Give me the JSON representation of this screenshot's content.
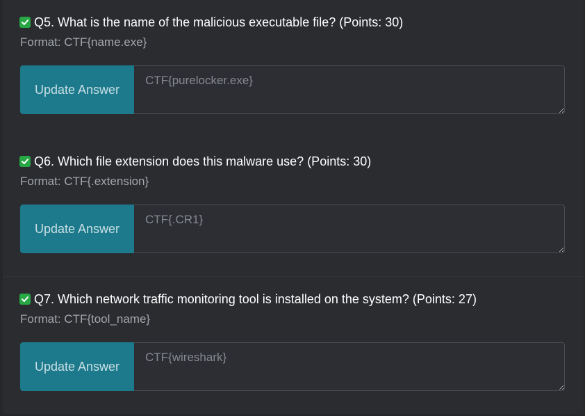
{
  "colors": {
    "background": "#25272b",
    "card": "#2a2c30",
    "accent_button": "#1d7a8c",
    "check": "#28a745",
    "title_text": "#ffffff",
    "muted_text": "#a3a6ab"
  },
  "questions": [
    {
      "check_icon": "check-square-icon",
      "title": "Q5. What is the name of the malicious executable file? (Points: 30)",
      "format": "Format: CTF{name.exe}",
      "button_label": "Update Answer",
      "answer_value": "",
      "answer_placeholder": "CTF{purelocker.exe}"
    },
    {
      "check_icon": "check-square-icon",
      "title": "Q6. Which file extension does this malware use? (Points: 30)",
      "format": "Format: CTF{.extension}",
      "button_label": "Update Answer",
      "answer_value": "",
      "answer_placeholder": "CTF{.CR1}"
    },
    {
      "check_icon": "check-square-icon",
      "title": "Q7. Which network traffic monitoring tool is installed on the system? (Points: 27)",
      "format": "Format: CTF{tool_name}",
      "button_label": "Update Answer",
      "answer_value": "",
      "answer_placeholder": "CTF{wireshark}"
    }
  ]
}
